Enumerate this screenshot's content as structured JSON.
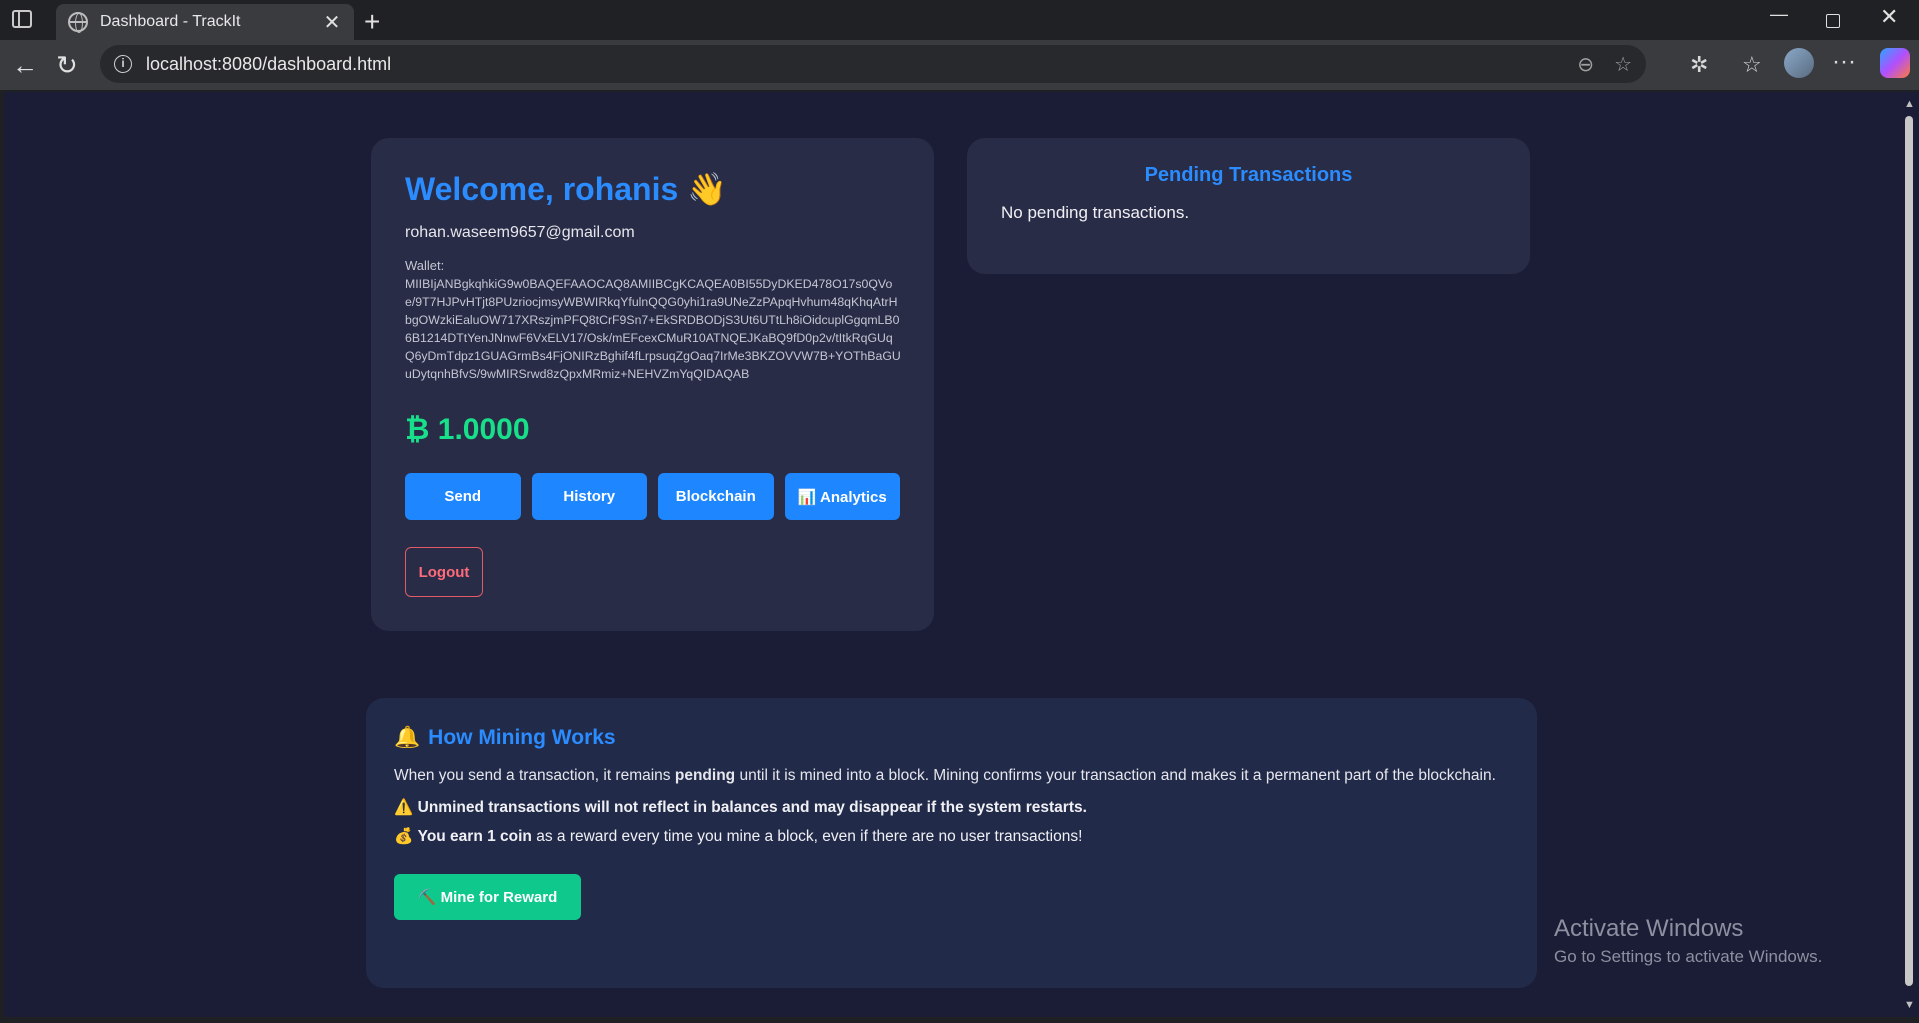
{
  "browser": {
    "tab_title": "Dashboard - TrackIt",
    "url": "localhost:8080/dashboard.html"
  },
  "user": {
    "welcome": "Welcome, rohanis 👋",
    "email": "rohan.waseem9657@gmail.com",
    "wallet_label": "Wallet:",
    "wallet_key": "MIIBIjANBgkqhkiG9w0BAQEFAAOCAQ8AMIIBCgKCAQEA0BI55DyDKED478O17s0QVoe/9T7HJPvHTjt8PUzriocjmsyWBWIRkqYfulnQQG0yhi1ra9UNeZzPApqHvhum48qKhqAtrHbgOWzkiEaluOW717XRszjmPFQ8tCrF9Sn7+EkSRDBODjS3Ut6UTtLh8iOidcuplGgqmLB06B1214DTtYenJNnwF6VxELV17/Osk/mEFcexCMuR10ATNQEJKaBQ9fD0p2v/tItkRqGUqQ6yDmTdpz1GUAGrmBs4FjONIRzBghif4fLrpsuqZgOaq7IrMe3BKZOVVW7B+YOThBaGUuDytqnhBfvS/9wMIRSrwd8zQpxMRmiz+NEHVZmYqQIDAQAB",
    "balance": "₿ 1.0000"
  },
  "actions": {
    "send": "Send",
    "history": "History",
    "blockchain": "Blockchain",
    "analytics": "📊 Analytics",
    "logout": "Logout"
  },
  "pending": {
    "title": "Pending Transactions",
    "empty": "No pending transactions."
  },
  "mining": {
    "icon": "🔔",
    "title": "How Mining Works",
    "desc_prefix": "When you send a transaction, it remains ",
    "desc_bold": "pending",
    "desc_suffix": " until it is mined into a block. Mining confirms your transaction and makes it a permanent part of the blockchain.",
    "warning_icon": "⚠️",
    "warning": "Unmined transactions will not reflect in balances and may disappear if the system restarts.",
    "earn_icon": "💰",
    "earn_bold": "You earn 1 coin",
    "earn_text": " as a reward every time you mine a block, even if there are no user transactions!",
    "button": "⛏️ Mine for Reward"
  },
  "watermark": {
    "title": "Activate Windows",
    "subtitle": "Go to Settings to activate Windows."
  }
}
